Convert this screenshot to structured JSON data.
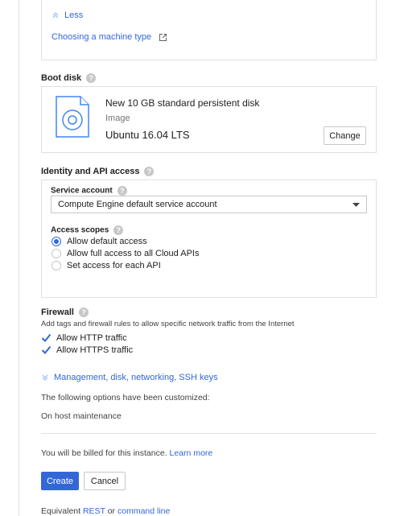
{
  "machine": {
    "less_label": "Less",
    "choosing_link": "Choosing a machine type"
  },
  "boot_disk": {
    "title": "Boot disk",
    "disk_name": "New 10 GB standard persistent disk",
    "image_label": "Image",
    "image_value": "Ubuntu 16.04 LTS",
    "change_button": "Change"
  },
  "identity": {
    "title": "Identity and API access",
    "service_account_label": "Service account",
    "service_account_value": "Compute Engine default service account",
    "access_scopes_label": "Access scopes",
    "scopes": [
      {
        "label": "Allow default access",
        "selected": true
      },
      {
        "label": "Allow full access to all Cloud APIs",
        "selected": false
      },
      {
        "label": "Set access for each API",
        "selected": false
      }
    ]
  },
  "firewall": {
    "title": "Firewall",
    "description": "Add tags and firewall rules to allow specific network traffic from the Internet",
    "http_label": "Allow HTTP traffic",
    "https_label": "Allow HTTPS traffic"
  },
  "management": {
    "link": "Management, disk, networking, SSH keys",
    "customized_note": "The following options have been customized:",
    "customized_item": "On host maintenance"
  },
  "billing": {
    "text": "You will be billed for this instance.",
    "learn_more": "Learn more"
  },
  "actions": {
    "create": "Create",
    "cancel": "Cancel"
  },
  "equivalent": {
    "prefix": "Equivalent",
    "rest": "REST",
    "or": "or",
    "command_line": "command line"
  },
  "colors": {
    "accent": "#3367d6",
    "border": "#e0e0e0"
  }
}
